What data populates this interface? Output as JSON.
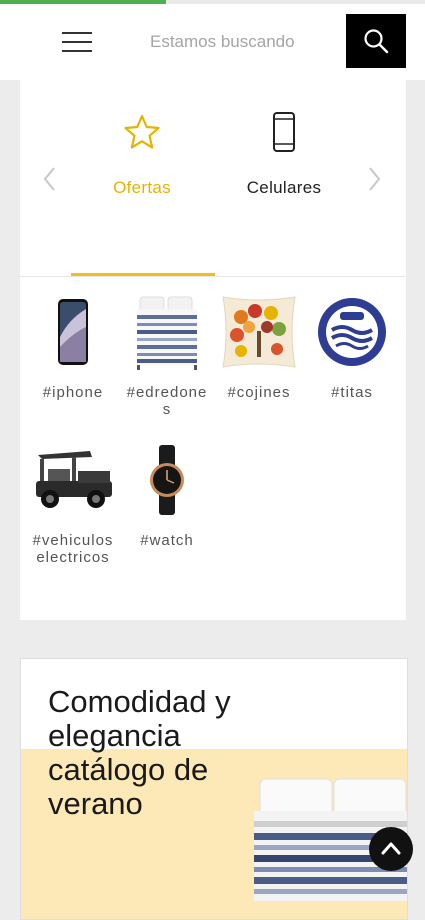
{
  "page_load_progress": 0.39,
  "header": {
    "search_placeholder": "Estamos buscando",
    "icons": {
      "menu": "hamburger-menu-icon",
      "search": "search-icon"
    }
  },
  "categories": {
    "tabs": [
      {
        "label": "Ofertas",
        "icon": "star-icon",
        "active": true,
        "color": "#e6b400"
      },
      {
        "label": "Celulares",
        "icon": "smartphone-icon",
        "active": false,
        "color": "#222222"
      }
    ],
    "prev_icon": "chevron-left-icon",
    "next_icon": "chevron-right-icon"
  },
  "tags": [
    {
      "label": "#iphone",
      "image": "phone-image"
    },
    {
      "label": "#edredones",
      "image": "bedding-image"
    },
    {
      "label": "#cojines",
      "image": "pillow-image"
    },
    {
      "label": "#titas",
      "image": "titas-logo-image"
    },
    {
      "label": "#vehiculoselectricos",
      "image": "electric-vehicle-image"
    },
    {
      "label": "#watch",
      "image": "watch-image"
    }
  ],
  "promo": {
    "title_lines": [
      "Comodidad y",
      "elegancia",
      "catálogo de",
      "verano"
    ],
    "band_color": "#fde8b8"
  },
  "scroll_top_icon": "chevron-up-icon"
}
